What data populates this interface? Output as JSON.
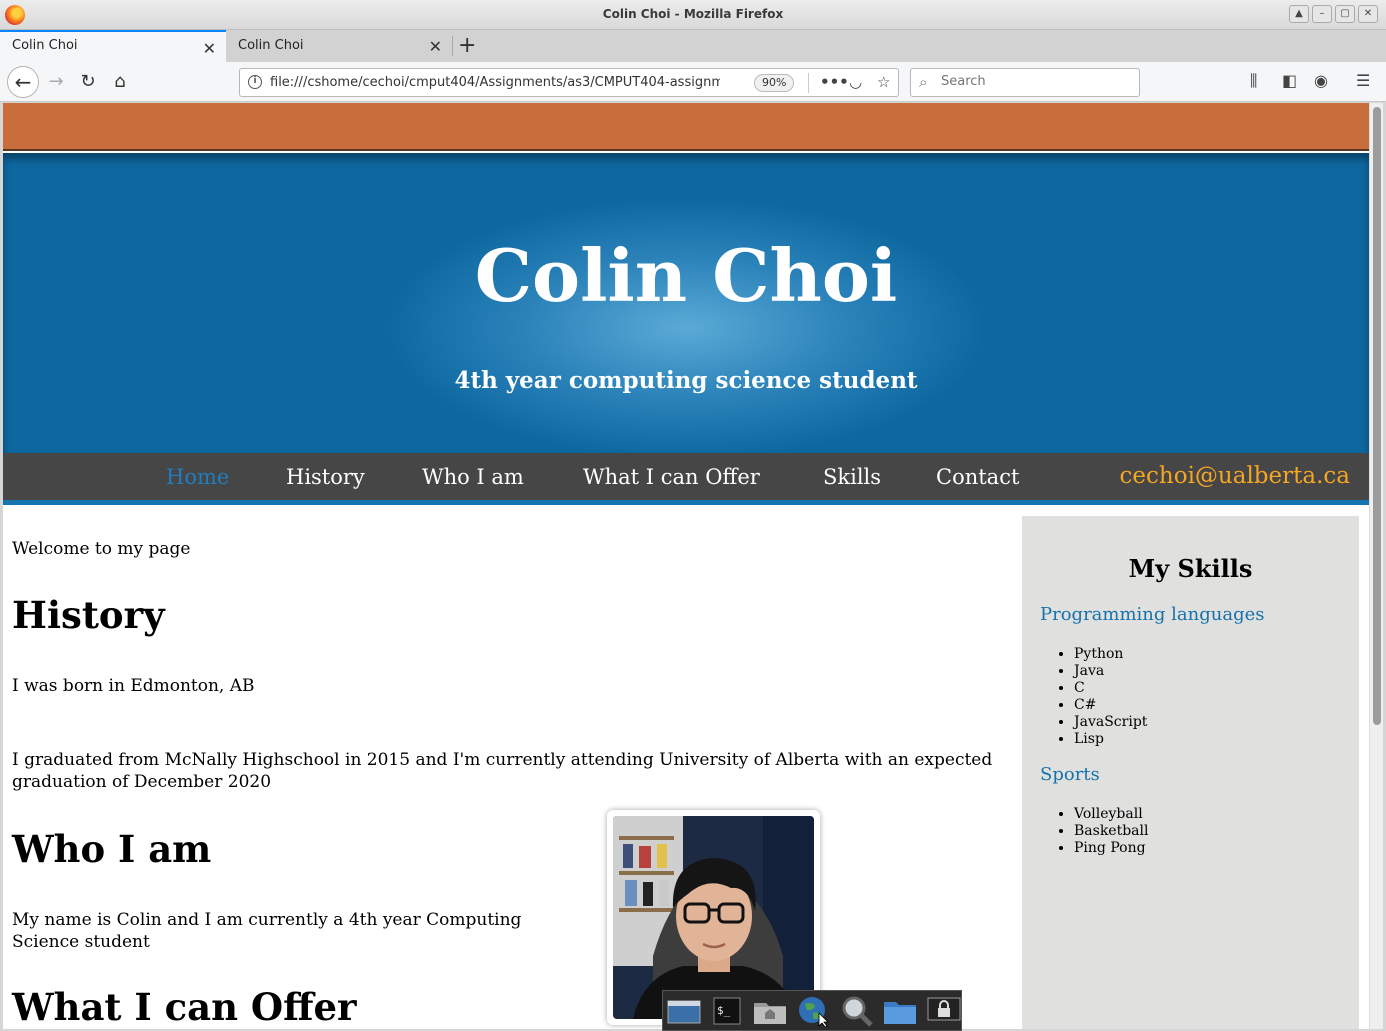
{
  "window": {
    "title": "Colin Choi - Mozilla Firefox"
  },
  "tabs": [
    {
      "label": "Colin Choi"
    },
    {
      "label": "Colin Choi"
    }
  ],
  "toolbar": {
    "url": "file:///cshome/cechoi/cmput404/Assignments/as3/CMPUT404-assignme",
    "zoom": "90%",
    "search_placeholder": "Search"
  },
  "page": {
    "name": "Colin Choi",
    "tagline": "4th year computing science student",
    "nav": [
      "Home",
      "History",
      "Who I am",
      "What I can Offer",
      "Skills",
      "Contact"
    ],
    "active_nav": "Home",
    "email": "cechoi@ualberta.ca",
    "welcome": "Welcome to my page",
    "history_heading": "History",
    "history_p1": "I was born in Edmonton, AB",
    "history_p2": "I graduated from McNally Highschool in 2015 and I'm currently attending University of Alberta with an expected graduation of December 2020",
    "whoami_heading": "Who I am",
    "whoami_p": "My name is Colin and I am currently a 4th year Computing Science student",
    "offer_heading": "What I can Offer"
  },
  "sidebar": {
    "title": "My Skills",
    "programming_heading": "Programming languages",
    "programming": [
      "Python",
      "Java",
      "C",
      "C#",
      "JavaScript",
      "Lisp"
    ],
    "sports_heading": "Sports",
    "sports": [
      "Volleyball",
      "Basketball",
      "Ping Pong"
    ]
  },
  "colors": {
    "top_strip": "#c86e3c",
    "hero_blue": "#1575b0",
    "nav_bg": "#464646",
    "nav_active": "#1f7fc0",
    "email": "#f5a623",
    "sidebar_bg": "#e0e0de",
    "sidebar_heading": "#1672ae"
  }
}
